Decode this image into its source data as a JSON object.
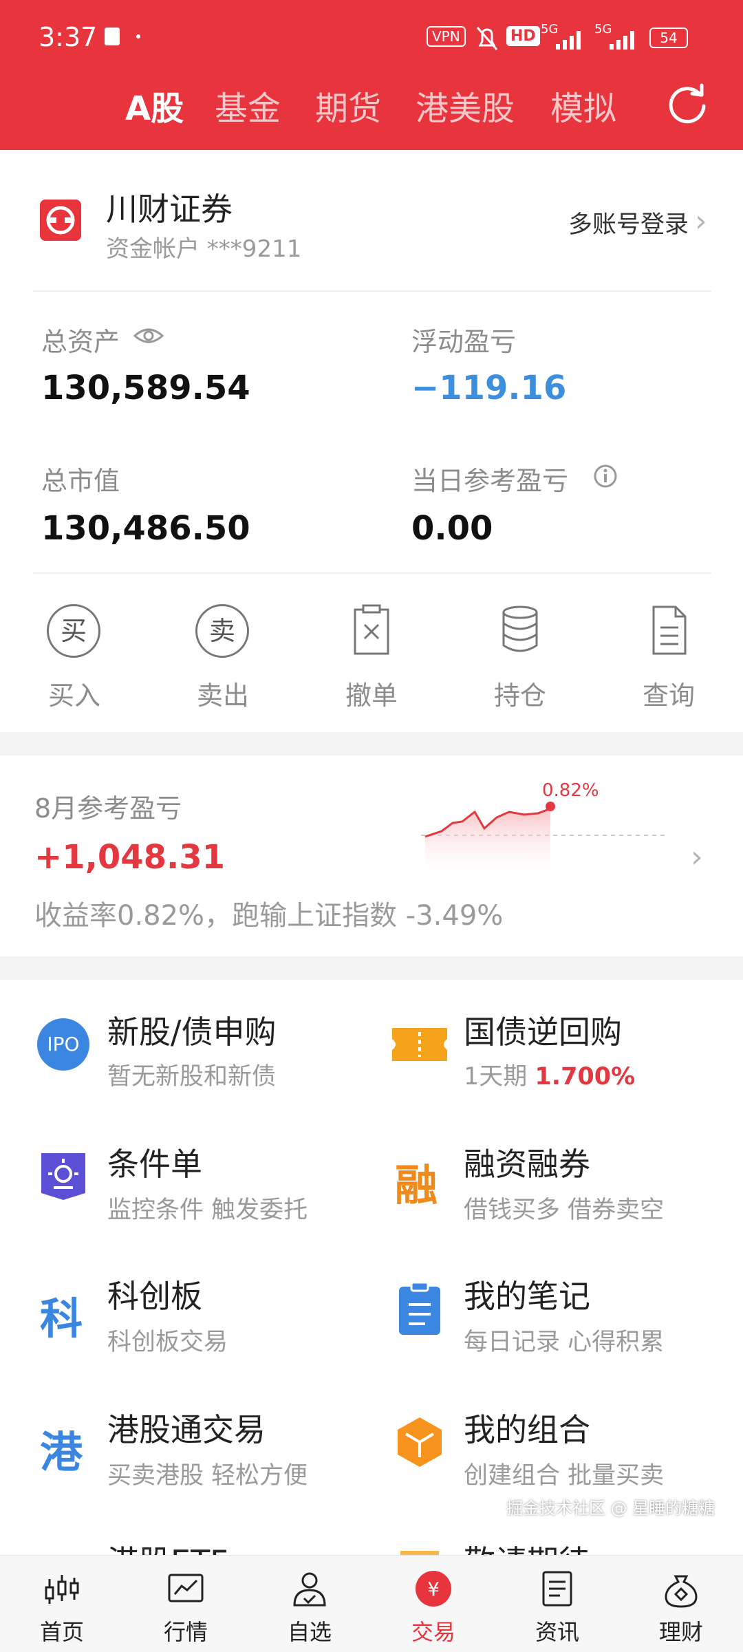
{
  "status_bar": {
    "time": "3:37",
    "vpn": "VPN",
    "battery": "54",
    "hd": "HD",
    "net1": "5G",
    "net2": "5G"
  },
  "tabs": [
    {
      "label": "A股",
      "active": true
    },
    {
      "label": "基金",
      "active": false
    },
    {
      "label": "期货",
      "active": false
    },
    {
      "label": "港美股",
      "active": false
    },
    {
      "label": "模拟",
      "active": false
    }
  ],
  "account": {
    "broker": "川财证券",
    "sub": "资金帐户 ***9211",
    "multi_login": "多账号登录"
  },
  "assets": {
    "total_assets_label": "总资产",
    "total_assets": "130,589.54",
    "float_pl_label": "浮动盈亏",
    "float_pl": "−119.16",
    "market_value_label": "总市值",
    "market_value": "130,486.50",
    "daily_pl_label": "当日参考盈亏",
    "daily_pl": "0.00"
  },
  "actions": [
    {
      "label": "买入",
      "glyph": "买",
      "icon": "buy-icon"
    },
    {
      "label": "卖出",
      "glyph": "卖",
      "icon": "sell-icon"
    },
    {
      "label": "撤单",
      "icon": "cancel-order-icon"
    },
    {
      "label": "持仓",
      "icon": "holdings-icon"
    },
    {
      "label": "查询",
      "icon": "query-icon"
    }
  ],
  "monthly": {
    "title": "8月参考盈亏",
    "value": "+1,048.31",
    "desc": "收益率0.82%，跑输上证指数 -3.49%",
    "chart_pct": "0.82%"
  },
  "services": [
    {
      "title": "新股/债申购",
      "sub": "暂无新股和新债",
      "icon": "ipo-icon",
      "icon_text": "IPO"
    },
    {
      "title": "国债逆回购",
      "sub": "1天期",
      "sub_highlight": "1.700%",
      "icon": "ticket-icon"
    },
    {
      "title": "条件单",
      "sub": "监控条件 触发委托",
      "icon": "condition-order-icon"
    },
    {
      "title": "融资融券",
      "sub": "借钱买多 借券卖空",
      "icon": "margin-icon",
      "icon_text": "融"
    },
    {
      "title": "科创板",
      "sub": "科创板交易",
      "icon": "star-market-icon",
      "icon_text": "科"
    },
    {
      "title": "我的笔记",
      "sub": "每日记录 心得积累",
      "icon": "notes-icon"
    },
    {
      "title": "港股通交易",
      "sub": "买卖港股 轻松方便",
      "icon": "hk-connect-icon",
      "icon_text": "港"
    },
    {
      "title": "我的组合",
      "sub": "创建组合 批量买卖",
      "icon": "portfolio-icon"
    },
    {
      "title": "港股ETF",
      "icon": "hk-etf-icon"
    },
    {
      "title": "敬请期待",
      "icon": "coming-soon-icon"
    }
  ],
  "nav": [
    {
      "label": "首页",
      "icon": "home-icon"
    },
    {
      "label": "行情",
      "icon": "market-icon"
    },
    {
      "label": "自选",
      "icon": "watchlist-icon"
    },
    {
      "label": "交易",
      "icon": "trade-icon",
      "active": true
    },
    {
      "label": "资讯",
      "icon": "news-icon"
    },
    {
      "label": "理财",
      "icon": "wealth-icon"
    }
  ],
  "watermark": "掘金技术社区 @ 星睡的糖糖",
  "colors": {
    "brand_red": "#e8343d",
    "loss_blue": "#3d8fdd",
    "gain_red": "#e3383f"
  }
}
